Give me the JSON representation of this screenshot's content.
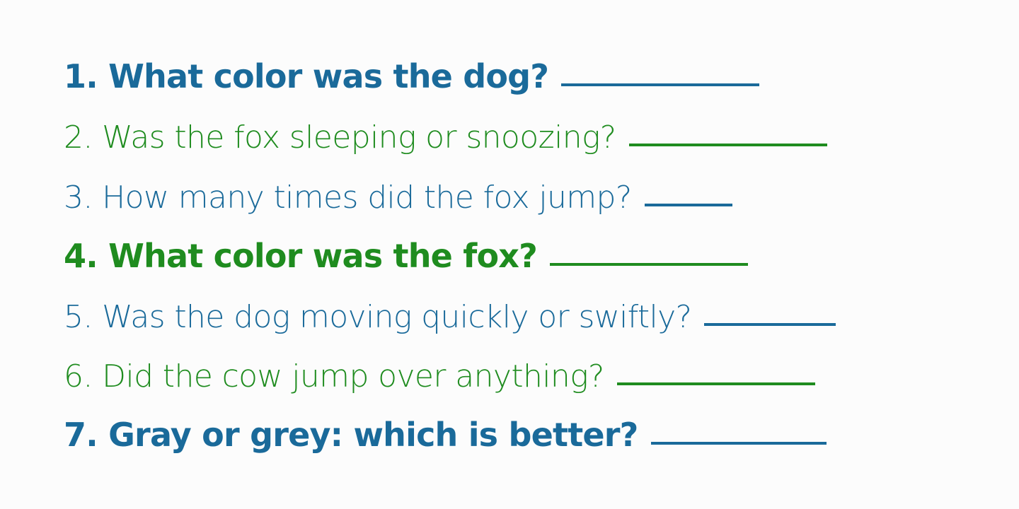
{
  "colors": {
    "blue": "#1a6a9a",
    "green": "#1f8c1f",
    "background": "#fcfcfc"
  },
  "questions": [
    {
      "text": "1. What color was the dog?",
      "color": "#1a6a9a",
      "bold": true
    },
    {
      "text": "2. Was the fox sleeping or snoozing?",
      "color": "#1f8c1f",
      "bold": false
    },
    {
      "text": "3. How many times did the fox jump?",
      "color": "#1a6a9a",
      "bold": false
    },
    {
      "text": "4. What color was the fox?",
      "color": "#1f8c1f",
      "bold": true
    },
    {
      "text": "5. Was the dog moving quickly or swiftly?",
      "color": "#1a6a9a",
      "bold": false
    },
    {
      "text": "6. Did the cow jump over anything?",
      "color": "#1f8c1f",
      "bold": false
    },
    {
      "text": "7. Gray or grey: which is better?",
      "color": "#1a6a9a",
      "bold": true
    }
  ]
}
